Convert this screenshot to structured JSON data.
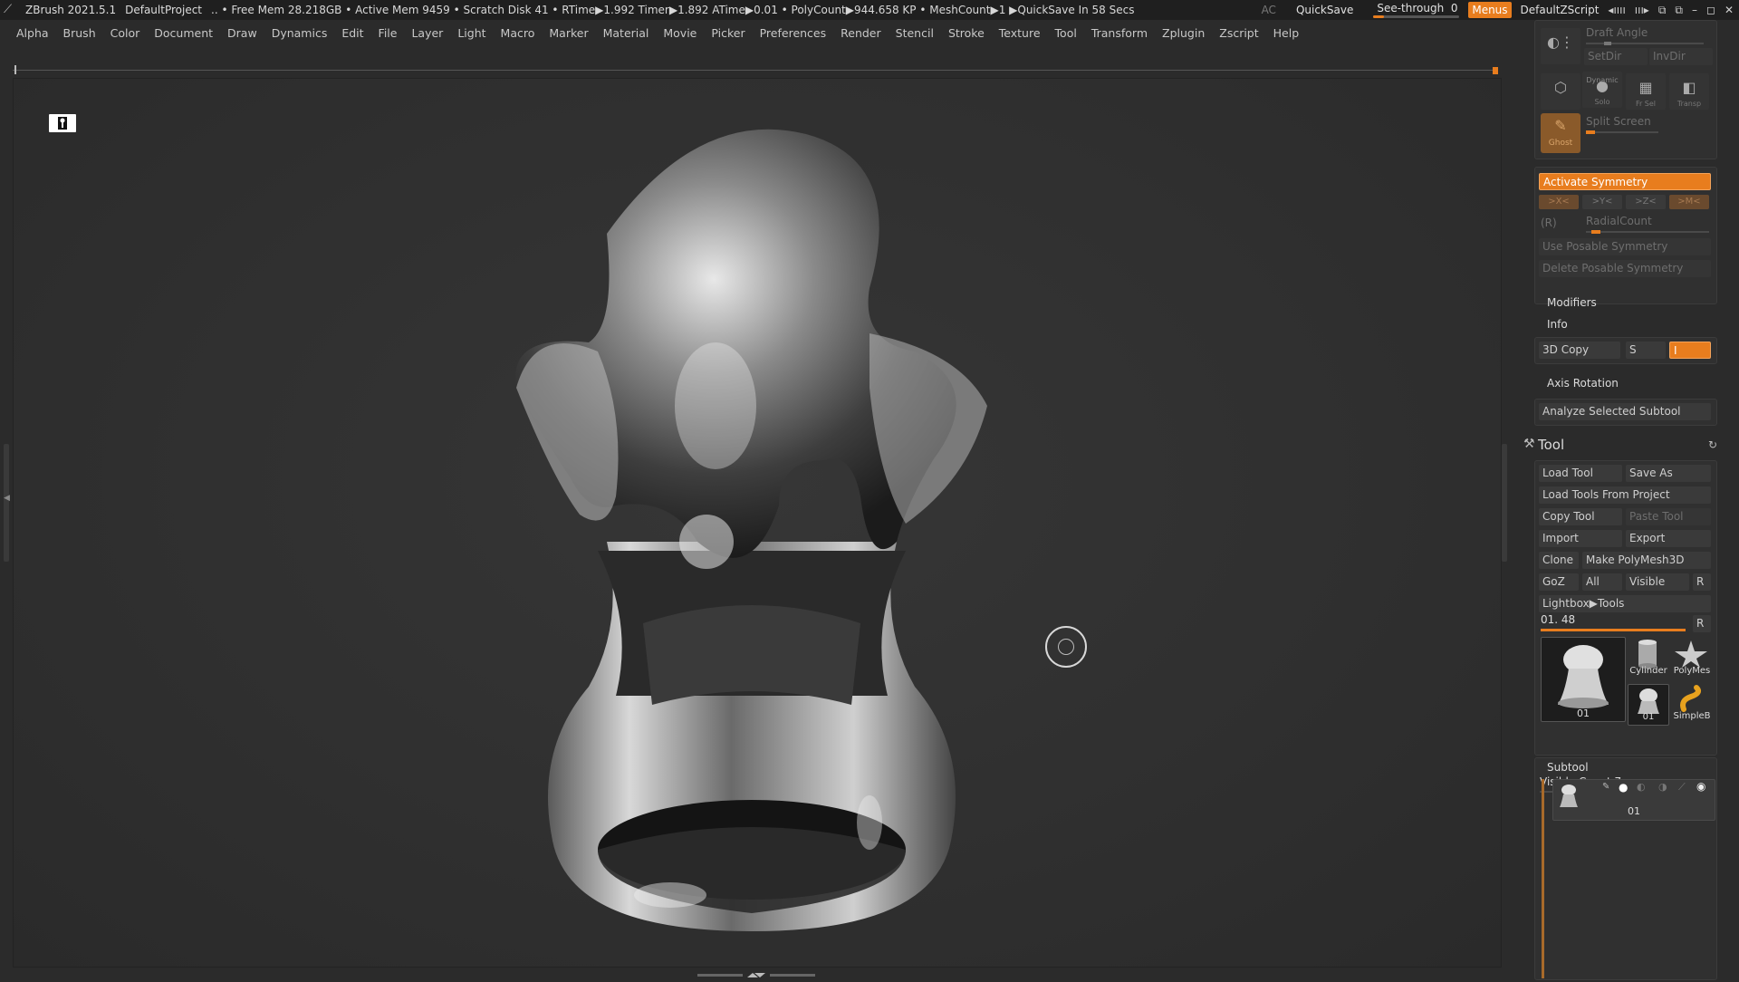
{
  "titlebar": {
    "app": "ZBrush 2021.5.1",
    "project": "DefaultProject",
    "stats": ".. • Free Mem 28.218GB • Active Mem 9459 • Scratch Disk 41 •  RTime▶1.992 Timer▶1.892 ATime▶0.01 • PolyCount▶944.658 KP  • MeshCount▶1  ▶QuickSave In 58 Secs",
    "ac": "AC",
    "quicksave": "QuickSave",
    "see_through_label": "See-through",
    "see_through_value": "0",
    "see_through_level": 0,
    "menus": "Menus",
    "script": "DefaultZScript",
    "icons": [
      "◂ıııı",
      "ııı▸",
      "⧉",
      "⧉",
      "–",
      "◻",
      "✕"
    ]
  },
  "menubar": [
    "Alpha",
    "Brush",
    "Color",
    "Document",
    "Draw",
    "Dynamics",
    "Edit",
    "File",
    "Layer",
    "Light",
    "Macro",
    "Marker",
    "Material",
    "Movie",
    "Picker",
    "Preferences",
    "Render",
    "Stencil",
    "Stroke",
    "Texture",
    "Tool",
    "Transform",
    "Zplugin",
    "Zscript",
    "Help"
  ],
  "panel": {
    "draft_angle": "Draft Angle",
    "setdir": "SetDir",
    "invdir": "InvDir",
    "dynamic": "Dynamic",
    "solo": "Solo",
    "frsel": "Fr Sel",
    "transp": "Transp",
    "ghost": "Ghost",
    "split_screen": "Split Screen",
    "activate_symmetry": "Activate Symmetry",
    "sym_x": ">X<",
    "sym_y": ">Y<",
    "sym_z": ">Z<",
    "sym_m": ">M<",
    "sym_r": "(R)",
    "radial_count": "RadialCount",
    "use_posable": "Use Posable Symmetry",
    "delete_posable": "Delete Posable Symmetry",
    "modifiers": "Modifiers",
    "info": "Info",
    "copy3d": "3D Copy",
    "copy_s": "S",
    "copy_i": "I",
    "axis_rotation": "Axis Rotation",
    "analyze": "Analyze Selected Subtool",
    "tool_title": "Tool",
    "load_tool": "Load Tool",
    "save_as": "Save As",
    "load_from_project": "Load Tools From Project",
    "copy_tool": "Copy Tool",
    "paste_tool": "Paste Tool",
    "import": "Import",
    "export": "Export",
    "clone": "Clone",
    "make_polymesh": "Make PolyMesh3D",
    "goz": "GoZ",
    "all": "All",
    "visible": "Visible",
    "r": "R",
    "lightbox_tools": "Lightbox▶Tools",
    "tool_slider_label": "01. 48",
    "tool_slider_r": "R",
    "thumb_main": "01",
    "thumb_cylinder": "Cylinder",
    "thumb_polymesh": "PolyMes",
    "thumb_small": "01",
    "thumb_simpleb": "SimpleB",
    "subtool": "Subtool",
    "visible_count": "Visible Count 7",
    "subtool_item": "01"
  },
  "colors": {
    "accent": "#e87d1e",
    "background": "#2b2b2b",
    "titlebar": "#1f1f1f"
  }
}
